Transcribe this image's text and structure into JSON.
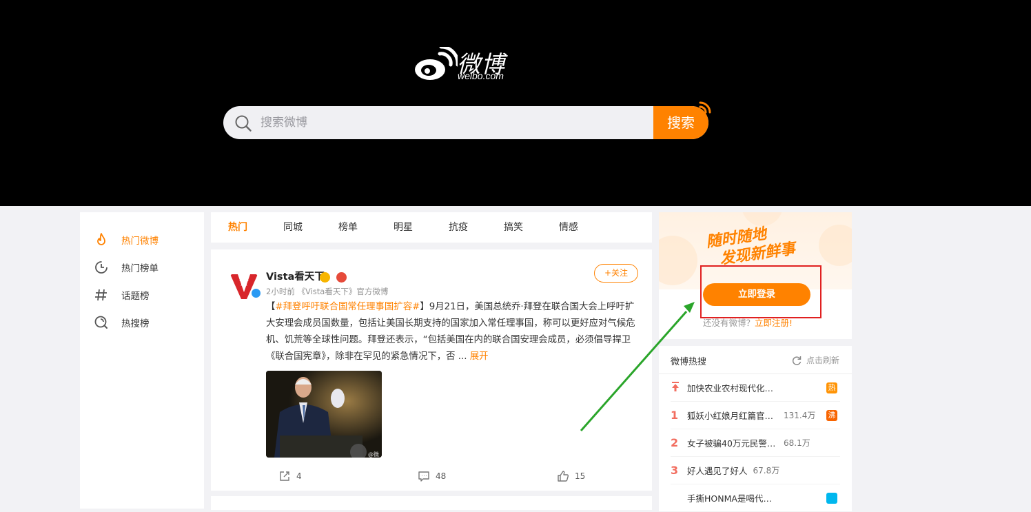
{
  "brand": {
    "logo_zh": "微博",
    "logo_en": "weibo.com",
    "accent": "#ff8200"
  },
  "search": {
    "placeholder": "搜索微博",
    "button": "搜索"
  },
  "leftnav": {
    "items": [
      {
        "label": "热门微博",
        "icon": "flame-icon",
        "active": true
      },
      {
        "label": "热门榜单",
        "icon": "clock-list-icon",
        "active": false
      },
      {
        "label": "话题榜",
        "icon": "hashtag-icon",
        "active": false
      },
      {
        "label": "热搜榜",
        "icon": "hot-search-icon",
        "active": false
      }
    ]
  },
  "tabs": [
    "热门",
    "同城",
    "榜单",
    "明星",
    "抗疫",
    "搞笑",
    "情感"
  ],
  "post": {
    "author": "Vista看天下",
    "meta": "2小时前 《Vista看天下》官方微博",
    "follow": "+关注",
    "text_open": "【",
    "tag": "#拜登呼吁联合国常任理事国扩容#",
    "text_body": "】9月21日，美国总统乔·拜登在联合国大会上呼吁扩大安理会成员国数量，包括让美国长期支持的国家加入常任理事国，称可以更好应对气候危机、饥荒等全球性问题。拜登还表示，“包括美国在内的联合国安理会成员，必须倡导捍卫《联合国宪章》，除非在罕见的紧急情况下，否 ... ",
    "more": "展开",
    "image_watermark": "@微",
    "actions": {
      "share": "4",
      "comment": "48",
      "like": "15"
    }
  },
  "login": {
    "slogan_line1": "随时随地",
    "slogan_line2": "发现新鲜事",
    "button": "立即登录",
    "register_prompt": "还没有微博？",
    "register_link": "立即注册!"
  },
  "hot": {
    "title": "微博热搜",
    "refresh": "点击刷新",
    "items": [
      {
        "rank": "",
        "text": "加快农业农村现代化步伐",
        "count": "",
        "badge": "热",
        "badge_color": "#ff9406"
      },
      {
        "rank": "1",
        "text": "狐妖小红娘月红篇官宣...",
        "count": "131.4万",
        "badge": "沸",
        "badge_color": "#f86400"
      },
      {
        "rank": "2",
        "text": "女子被骗40万元民警追回...",
        "count": "68.1万",
        "badge": "",
        "badge_color": ""
      },
      {
        "rank": "3",
        "text": "好人遇见了好人",
        "count": "67.8万",
        "badge": "",
        "badge_color": ""
      },
      {
        "rank": "",
        "text": "手撕HONMA是喝代言人",
        "count": "",
        "badge": "",
        "badge_color": "#00b7ee"
      }
    ]
  }
}
